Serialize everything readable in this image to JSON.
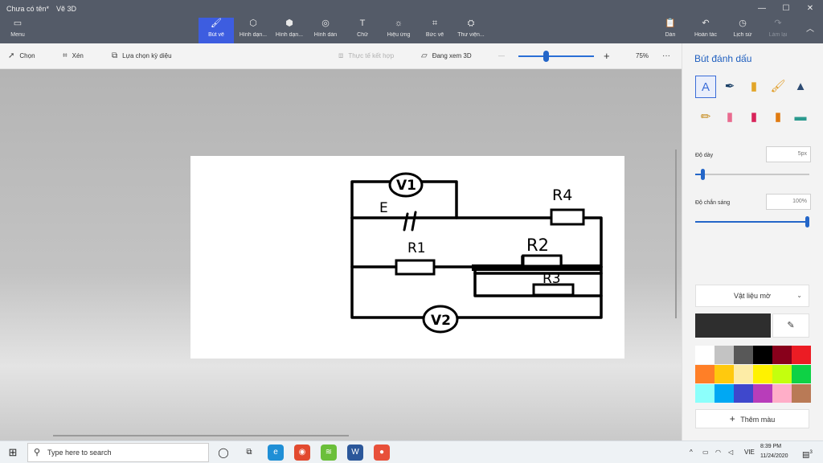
{
  "window": {
    "document_title": "Chưa có tên*",
    "app_name": "Vẽ 3D",
    "minimize": "—",
    "maximize": "☐",
    "close": "✕"
  },
  "ribbon": {
    "menu": {
      "label": "Menu",
      "icon": "menu-icon"
    },
    "tools": [
      {
        "label": "Bút vẽ",
        "icon": "brush-icon",
        "active": true
      },
      {
        "label": "Hình dạn...",
        "icon": "2d-shapes-icon"
      },
      {
        "label": "Hình dạn...",
        "icon": "3d-shapes-icon"
      },
      {
        "label": "Hình dán",
        "icon": "stickers-icon"
      },
      {
        "label": "Chữ",
        "icon": "text-icon"
      },
      {
        "label": "Hiệu ứng",
        "icon": "effects-icon"
      },
      {
        "label": "Bức vẽ",
        "icon": "canvas-icon"
      },
      {
        "label": "Thư viện...",
        "icon": "library-icon"
      }
    ],
    "right_tools": [
      {
        "label": "Dán",
        "icon": "paste-icon"
      },
      {
        "label": "Hoàn tác",
        "icon": "undo-icon"
      },
      {
        "label": "Lịch sử",
        "icon": "history-icon"
      },
      {
        "label": "Làm lại",
        "icon": "redo-icon",
        "disabled": true
      }
    ],
    "collapse": "︿"
  },
  "toolbar": {
    "select": "Chọn",
    "crop": "Xén",
    "magic_select": "Lựa chọn kỳ diệu",
    "mixed_reality": "Thực tế kết hợp",
    "view_3d": "Đang xem 3D",
    "zoom_minus": "—",
    "zoom_plus": "+",
    "zoom_level": "75%",
    "more": "···",
    "zoom_fraction": 0.35
  },
  "panel": {
    "title": "Bút đánh dấu",
    "brushes": [
      {
        "name": "marker-icon",
        "glyph": "A"
      },
      {
        "name": "calligraphy-pen-icon",
        "glyph": "✒"
      },
      {
        "name": "oil-brush-icon",
        "glyph": "▮"
      },
      {
        "name": "watercolor-icon",
        "glyph": "🖌"
      },
      {
        "name": "pixel-pen-icon",
        "glyph": "▲"
      },
      {
        "name": "pencil-icon",
        "glyph": "✏"
      },
      {
        "name": "eraser-icon",
        "glyph": "▮"
      },
      {
        "name": "crayon-icon",
        "glyph": "▮"
      },
      {
        "name": "spraycan-icon",
        "glyph": "▮"
      },
      {
        "name": "fill-icon",
        "glyph": "▬"
      }
    ],
    "thickness_label": "Độ dày",
    "thickness_value": "5px",
    "thickness_fraction": 0.05,
    "opacity_label": "Độ chắn sáng",
    "opacity_value": "100%",
    "opacity_fraction": 1.0,
    "material": "Vật liệu mờ",
    "current_color": "#2e2e2e",
    "more_colors": "Thêm màu",
    "palette": [
      "#ffffff",
      "#c3c3c3",
      "#585858",
      "#000000",
      "#88001b",
      "#ec1c24",
      "#ff7f27",
      "#ffc90e",
      "#fdeca6",
      "#fff200",
      "#c4ff0e",
      "#0ed145",
      "#8cfffb",
      "#00a8f3",
      "#3f48cc",
      "#b83dba",
      "#ffaec8",
      "#b97a56"
    ]
  },
  "drawing": {
    "labels": {
      "v1": "V1",
      "v2": "V2",
      "e": "E",
      "r1": "R1",
      "r2": "R2",
      "r3": "R3",
      "r4": "R4"
    }
  },
  "taskbar": {
    "search_placeholder": "Type here to search",
    "apps": [
      {
        "name": "task-view-icon",
        "glyph": "◯"
      },
      {
        "name": "taskview-timeline-icon",
        "glyph": "⧉"
      },
      {
        "name": "edge-icon",
        "glyph": "e",
        "color": "#1f8fd6"
      },
      {
        "name": "chrome-icon",
        "glyph": "◉",
        "color": "#e24a2f"
      },
      {
        "name": "bluestacks-icon",
        "glyph": "≋",
        "color": "#6bbf3a"
      },
      {
        "name": "word-icon",
        "glyph": "W",
        "color": "#2b579a"
      },
      {
        "name": "paint3d-icon",
        "glyph": "●",
        "color": "#e8503a"
      }
    ],
    "tray": {
      "lang": "VIE",
      "time": "8:39 PM",
      "date": "11/24/2020",
      "notifications": "3"
    }
  }
}
